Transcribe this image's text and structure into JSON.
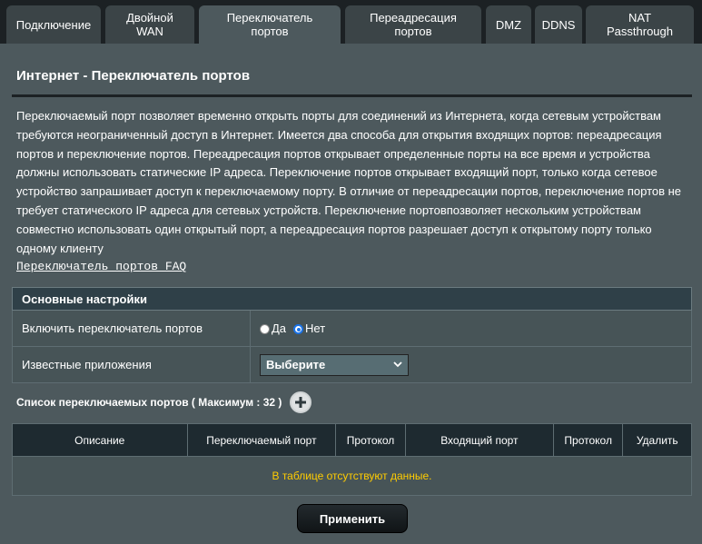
{
  "tabs": [
    {
      "label": "Подключение"
    },
    {
      "label": "Двойной WAN"
    },
    {
      "label": "Переключатель портов"
    },
    {
      "label": "Переадресация портов"
    },
    {
      "label": "DMZ"
    },
    {
      "label": "DDNS"
    },
    {
      "label": "NAT Passthrough"
    }
  ],
  "page": {
    "title": "Интернет - Переключатель портов",
    "description": "Переключаемый порт позволяет временно открыть порты для соединений из Интернета, когда сетевым устройствам требуются неограниченный доступ в Интернет. Имеется два способа для открытия входящих портов: переадресация портов и переключение портов. Переадресация портов открывает определенные порты на все время и устройства должны использовать статические IP адреса. Переключение портов открывает входящий порт, только когда сетевое устройство запрашивает доступ к переключаемому порту. В отличие от переадресации портов, переключение портов не требует статического IP адреса для сетевых устройств. Переключение портовпозволяет нескольким устройствам совместно использовать один открытый порт, а переадресация портов разрешает доступ к открытому порту только одному клиенту",
    "faq_link": "Переключатель портов FAQ"
  },
  "settings": {
    "header": "Основные настройки",
    "enable_label": "Включить переключатель портов",
    "yes_label": "Да",
    "no_label": "Нет",
    "selected": "Нет",
    "apps_label": "Известные приложения",
    "apps_select": "Выберите"
  },
  "list": {
    "title": "Список переключаемых портов ( Максимум : 32 )",
    "columns": [
      "Описание",
      "Переключаемый порт",
      "Протокол",
      "Входящий порт",
      "Протокол",
      "Удалить"
    ],
    "empty_text": "В таблице отсутствуют данные."
  },
  "apply_label": "Применить",
  "colors": {
    "accent": "#ffcc00",
    "panel": "#4d595d",
    "tab": "#3b4447"
  }
}
